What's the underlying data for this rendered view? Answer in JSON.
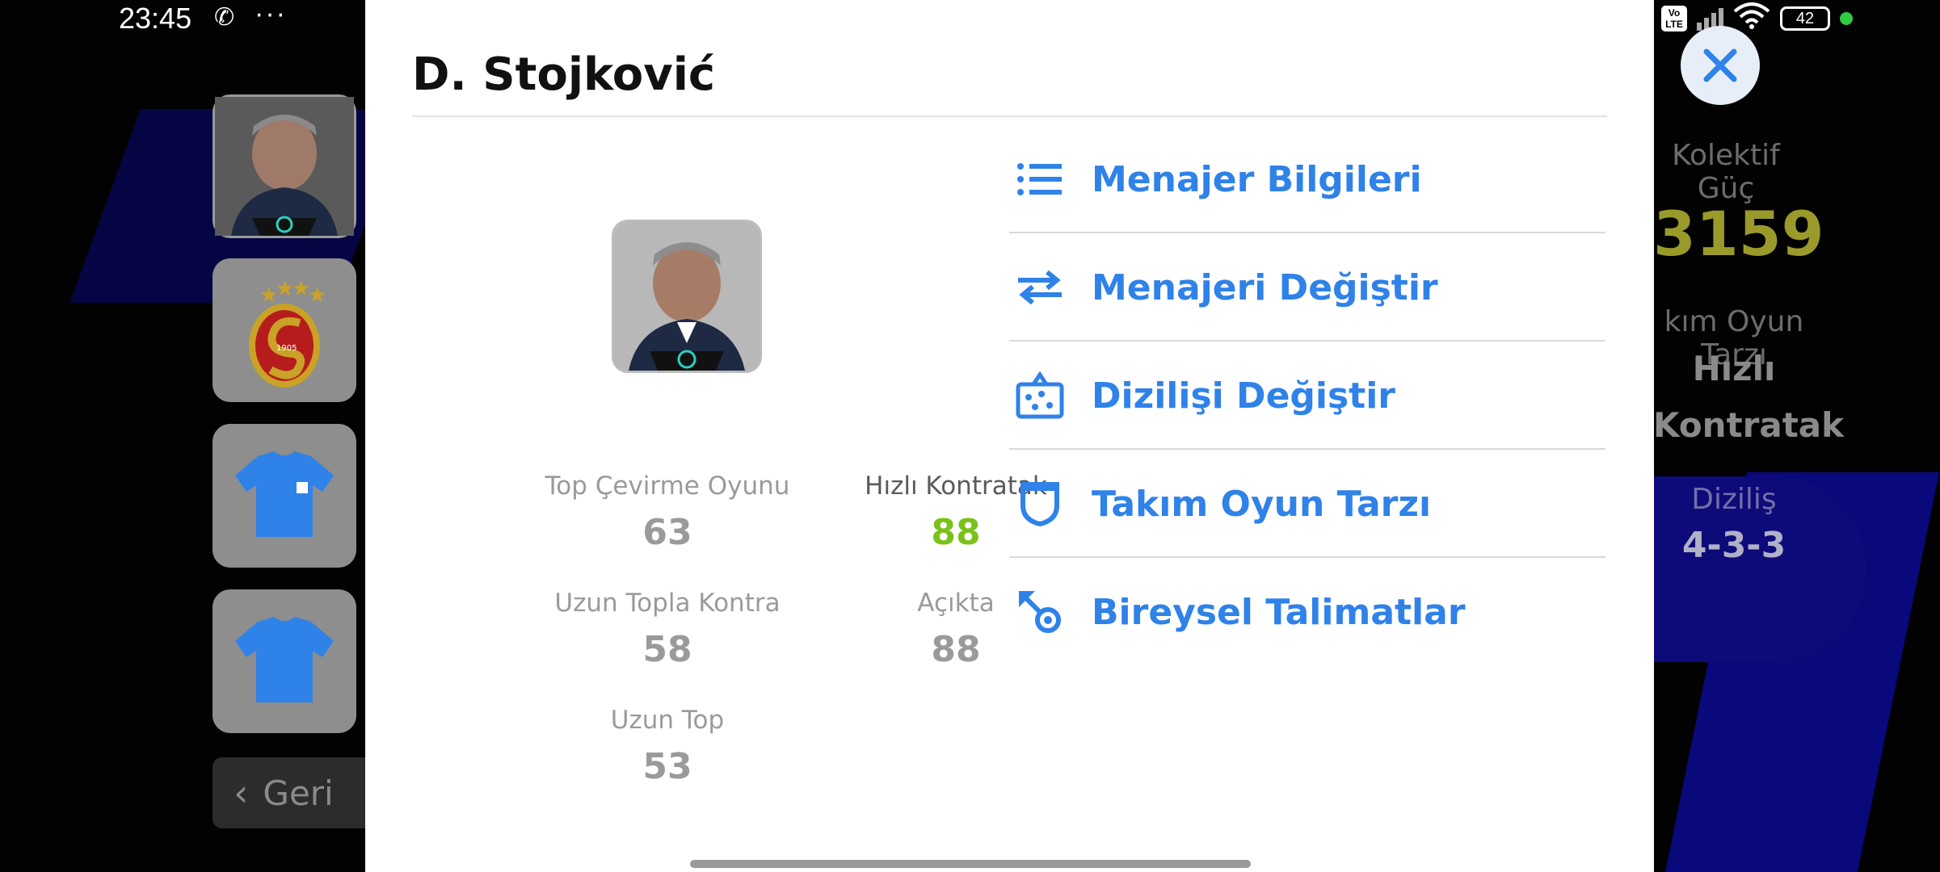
{
  "status_bar": {
    "time": "23:45",
    "battery": "42",
    "lte": "Vo LTE",
    "wifi_sub": "6"
  },
  "modal": {
    "title": "D. Stojković",
    "stats": [
      {
        "label": "Top Çevirme Oyunu",
        "value": "63",
        "highlight": false
      },
      {
        "label": "Hızlı Kontratak",
        "value": "88",
        "highlight": true
      },
      {
        "label": "Uzun Topla Kontra",
        "value": "58",
        "highlight": false
      },
      {
        "label": "Açıkta",
        "value": "88",
        "highlight": false
      },
      {
        "label": "Uzun Top",
        "value": "53",
        "highlight": false
      }
    ],
    "menu": [
      {
        "label": "Menajer Bilgileri",
        "icon": "list-icon"
      },
      {
        "label": "Menajeri Değiştir",
        "icon": "swap-arrows-icon"
      },
      {
        "label": "Dizilişi Değiştir",
        "icon": "formation-board-icon"
      },
      {
        "label": "Takım Oyun Tarzı",
        "icon": "shield-icon"
      },
      {
        "label": "Bireysel Talimatlar",
        "icon": "arrow-target-icon"
      }
    ]
  },
  "left_panel": {
    "back_label": "Geri",
    "crest_year": "1905"
  },
  "right_panel": {
    "strength_label": "Kolektif Güç",
    "strength_value": "3159",
    "style_label": "kım Oyun Tarzı",
    "style_value_1": "Hızlı",
    "style_value_2": "Kontratak",
    "formation_label": "Diziliş",
    "formation_value": "4-3-3"
  },
  "colors": {
    "accent": "#2f82e8",
    "highlight": "#7ac11a",
    "strength": "#9a9a2a"
  }
}
